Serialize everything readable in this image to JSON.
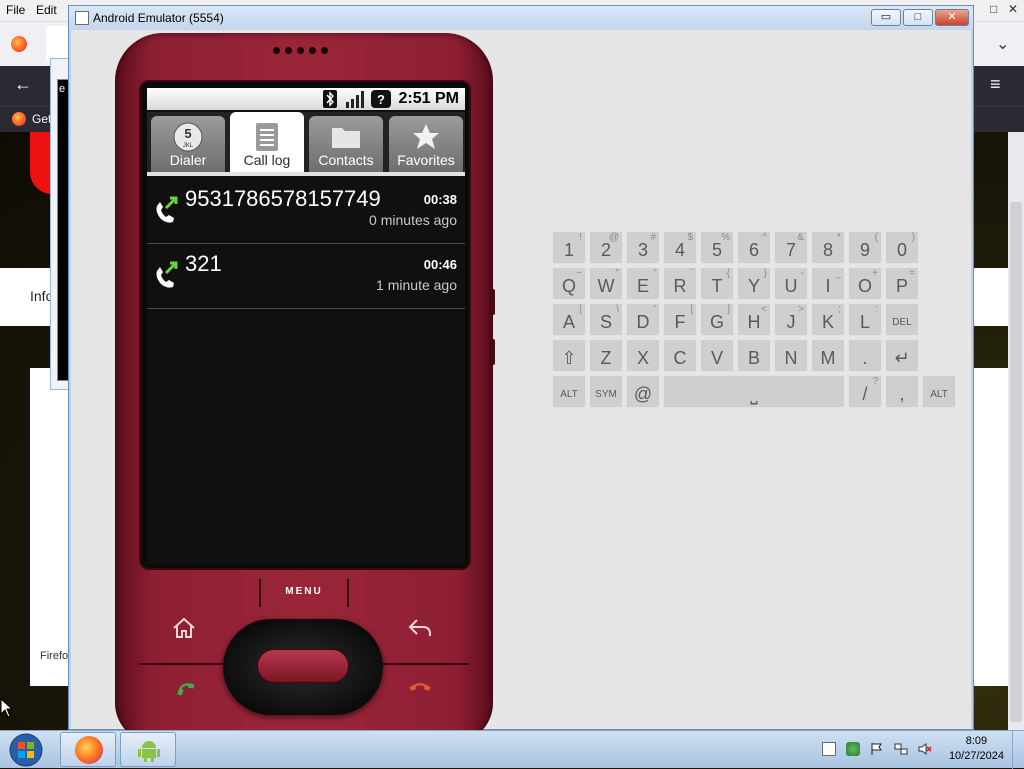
{
  "firefox": {
    "menu": [
      "File",
      "Edit"
    ],
    "bookmark_label": "Get",
    "partial_text_1": "Info",
    "partial_text_2": "Firefo",
    "partial_text_3": "e"
  },
  "emulator": {
    "window_title": "Android Emulator (5554)",
    "buttons": {
      "minimize": "▭",
      "maximize": "□",
      "close": "✕"
    }
  },
  "phone": {
    "status_time": "2:51 PM",
    "tabs": [
      {
        "label": "Dialer",
        "icon": "dialpad-5-jkl-icon",
        "selected": false
      },
      {
        "label": "Call log",
        "icon": "call-log-icon",
        "selected": true
      },
      {
        "label": "Contacts",
        "icon": "contacts-folder-icon",
        "selected": false
      },
      {
        "label": "Favorites",
        "icon": "star-icon",
        "selected": false
      }
    ],
    "calls": [
      {
        "number": "9531786578157749",
        "duration": "00:38",
        "when": "0 minutes ago",
        "type": "outgoing"
      },
      {
        "number": "321",
        "duration": "00:46",
        "when": "1 minute ago",
        "type": "outgoing"
      }
    ],
    "menu_label": "MENU"
  },
  "keyboard": {
    "row1": [
      [
        "1",
        "!"
      ],
      [
        "2",
        "@"
      ],
      [
        "3",
        "#"
      ],
      [
        "4",
        "$"
      ],
      [
        "5",
        "%"
      ],
      [
        "6",
        "^"
      ],
      [
        "7",
        "&"
      ],
      [
        "8",
        "*"
      ],
      [
        "9",
        "("
      ],
      [
        "0",
        ")"
      ]
    ],
    "row2": [
      [
        "Q",
        "~"
      ],
      [
        "W",
        "\""
      ],
      [
        "E",
        "'"
      ],
      [
        "R",
        "`"
      ],
      [
        "T",
        "{"
      ],
      [
        "Y",
        "}"
      ],
      [
        "U",
        "-"
      ],
      [
        "I",
        "_"
      ],
      [
        "O",
        "+"
      ],
      [
        "P",
        "="
      ]
    ],
    "row3": [
      [
        "A",
        "|"
      ],
      [
        "S",
        "\\"
      ],
      [
        "D",
        "'"
      ],
      [
        "F",
        "["
      ],
      [
        "G",
        "]"
      ],
      [
        "H",
        "<"
      ],
      [
        "J",
        ">"
      ],
      [
        "K",
        ";"
      ],
      [
        "L",
        ":"
      ],
      [
        "DEL",
        ""
      ]
    ],
    "row4": [
      [
        "⇧",
        ""
      ],
      [
        "Z",
        ""
      ],
      [
        "X",
        ""
      ],
      [
        "C",
        ""
      ],
      [
        "V",
        ""
      ],
      [
        "B",
        ""
      ],
      [
        "N",
        ""
      ],
      [
        "M",
        ""
      ],
      [
        ".",
        ""
      ],
      [
        "↵",
        ""
      ]
    ],
    "row5": [
      [
        "ALT",
        ""
      ],
      [
        "SYM",
        ""
      ],
      [
        "@",
        ""
      ],
      [
        "⎵",
        ""
      ],
      [
        "/",
        "?"
      ],
      [
        ",",
        ""
      ],
      [
        "ALT",
        ""
      ]
    ]
  },
  "taskbar": {
    "time": "8:09",
    "date": "10/27/2024"
  }
}
